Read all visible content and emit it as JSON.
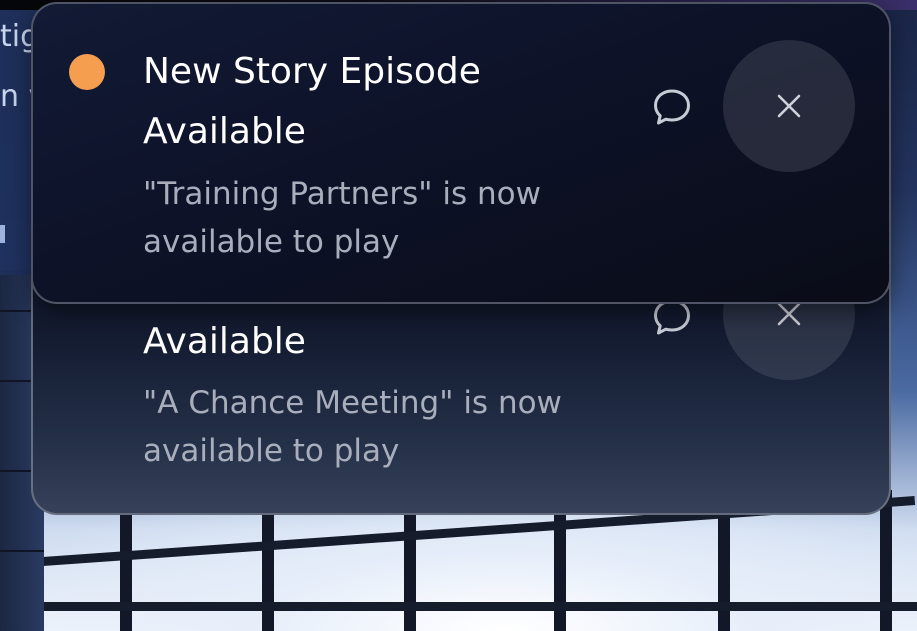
{
  "background": {
    "fragment_line_1": "tig",
    "fragment_line_2": "n v"
  },
  "notifications": [
    {
      "title": "New Story Episode Available",
      "body": "\"Training Partners\" is now available to play",
      "unread": true,
      "unread_color": "#f59e50",
      "actions": {
        "reply_icon": "chat-bubble-icon",
        "close_icon": "close-icon"
      }
    },
    {
      "title": "Available",
      "body": "\"A Chance Meeting\" is now available to play",
      "unread": false,
      "actions": {
        "reply_icon": "chat-bubble-icon",
        "close_icon": "close-icon"
      }
    }
  ],
  "colors": {
    "card_background": "#0d1228",
    "title_text": "#ffffff",
    "body_text": "#a9aebc",
    "close_button": "#484c5c"
  }
}
